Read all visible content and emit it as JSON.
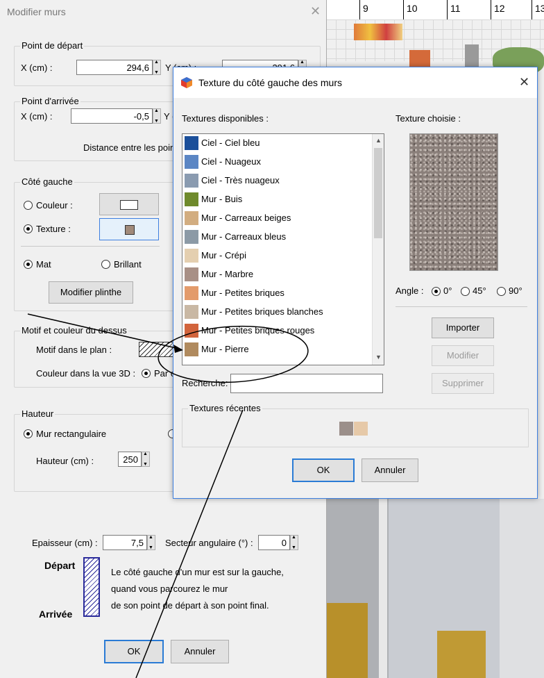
{
  "background": {
    "ruler_ticks": [
      "9",
      "10",
      "11",
      "12",
      "13"
    ]
  },
  "wall_dialog": {
    "title": "Modifier murs",
    "start": {
      "group_label": "Point de départ",
      "x_label": "X (cm) :",
      "x_value": "294,6",
      "y_label": "Y (cm) :",
      "y_value": "391,6"
    },
    "end": {
      "group_label": "Point d'arrivée",
      "x_label": "X (cm) :",
      "x_value": "-0,5",
      "y_label": "Y (c",
      "distance_label": "Distance entre les point"
    },
    "left_side": {
      "group_label": "Côté gauche",
      "color_label": "Couleur :",
      "texture_label": "Texture :",
      "selected": "texture",
      "matte_label": "Mat",
      "shiny_label": "Brillant",
      "finish_selected": "matte",
      "baseboard_button": "Modifier plinthe"
    },
    "top": {
      "group_label": "Motif et couleur du dessus",
      "pattern_label": "Motif dans le plan :",
      "color3d_label": "Couleur dans la vue 3D :",
      "color3d_option": "Par c"
    },
    "height": {
      "group_label": "Hauteur",
      "rect_label": "Mur rectangulaire",
      "height_label": "Hauteur (cm) :",
      "height_value": "250"
    },
    "thickness_label": "Epaisseur (cm) :",
    "thickness_value": "7,5",
    "arc_label": "Secteur angulaire (°) :",
    "arc_value": "0",
    "start_text": "Départ",
    "end_text": "Arrivée",
    "explanation": [
      "Le côté gauche d'un mur est sur la gauche,",
      "quand vous parcourez le mur",
      "de son point de départ à son point final."
    ],
    "ok": "OK",
    "cancel": "Annuler"
  },
  "texture_dialog": {
    "title": "Texture du côté gauche des murs",
    "available_label": "Textures disponibles :",
    "chosen_label": "Texture choisie :",
    "items": [
      {
        "label": "Ciel - Ciel bleu",
        "color": "#1b4f9a"
      },
      {
        "label": "Ciel - Nuageux",
        "color": "#5b86c4"
      },
      {
        "label": "Ciel - Très nuageux",
        "color": "#8a9bb0"
      },
      {
        "label": "Mur - Buis",
        "color": "#6f8a2c"
      },
      {
        "label": "Mur - Carreaux beiges",
        "color": "#d2ad80"
      },
      {
        "label": "Mur - Carreaux bleus",
        "color": "#8c9aa6"
      },
      {
        "label": "Mur - Crépi",
        "color": "#e4cfb0"
      },
      {
        "label": "Mur - Marbre",
        "color": "#a89086"
      },
      {
        "label": "Mur - Petites briques",
        "color": "#e39b6b"
      },
      {
        "label": "Mur - Petites briques blanches",
        "color": "#c9b8a4"
      },
      {
        "label": "Mur - Petites briques rouges",
        "color": "#d2643c"
      },
      {
        "label": "Mur - Pierre",
        "color": "#b08a5e"
      }
    ],
    "angle_label": "Angle :",
    "angle_options": [
      "0°",
      "45°",
      "90°"
    ],
    "angle_selected": "0°",
    "import_button": "Importer",
    "modify_button": "Modifier",
    "delete_button": "Supprimer",
    "search_label": "Recherche:",
    "search_value": "",
    "recent_label": "Textures récentes",
    "recent_colors": [
      "#9b8f8a",
      "#e6c9a8"
    ],
    "ok": "OK",
    "cancel": "Annuler",
    "accent_color": "#2a7bd5"
  }
}
